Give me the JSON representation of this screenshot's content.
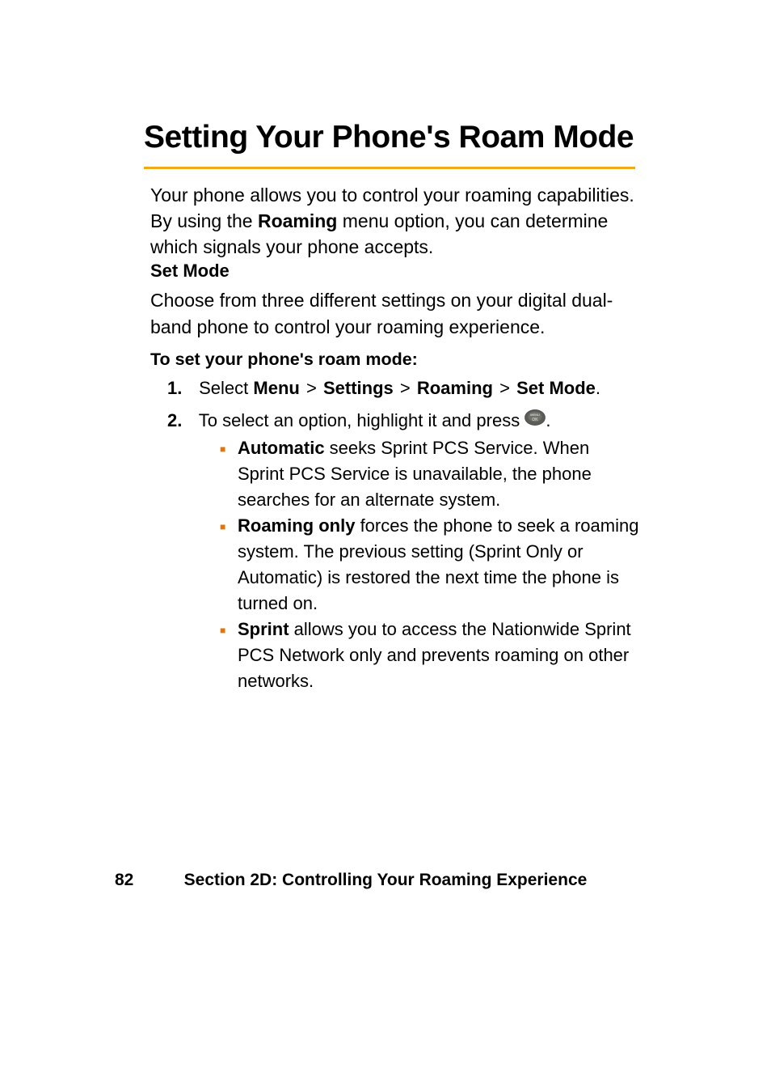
{
  "heading": "Setting Your Phone's Roam Mode",
  "intro_parts": {
    "a": "Your phone allows you to control your roaming capabilities. By using the ",
    "b": "Roaming",
    "c": " menu option, you can determine which signals your phone accepts."
  },
  "subheading": "Set Mode",
  "subintro": "Choose from three different settings on your digital dual-band phone to control your roaming experience.",
  "toset": "To set your phone's roam mode:",
  "steps": {
    "s1": {
      "num": "1.",
      "a": "Select ",
      "menu": "Menu",
      "gt1": ">",
      "settings": "Settings",
      "gt2": ">",
      "roaming": "Roaming",
      "gt3": ">",
      "setmode": "Set Mode",
      "period": "."
    },
    "s2": {
      "num": "2.",
      "a": "To select an option, highlight it and press ",
      "period": "."
    }
  },
  "bullets": {
    "b1": {
      "title": "Automatic",
      "rest": " seeks Sprint PCS Service. When Sprint PCS Service is unavailable, the phone searches for an alternate system."
    },
    "b2": {
      "title": "Roaming only",
      "rest": " forces the phone to seek a roaming system. The previous setting (Sprint Only or Automatic) is restored the next time the phone is turned on."
    },
    "b3": {
      "title": "Sprint",
      "rest": " allows you to access the Nationwide Sprint PCS Network only and prevents roaming on other networks."
    }
  },
  "footer": {
    "page": "82",
    "section": "Section 2D: Controlling Your Roaming Experience"
  }
}
